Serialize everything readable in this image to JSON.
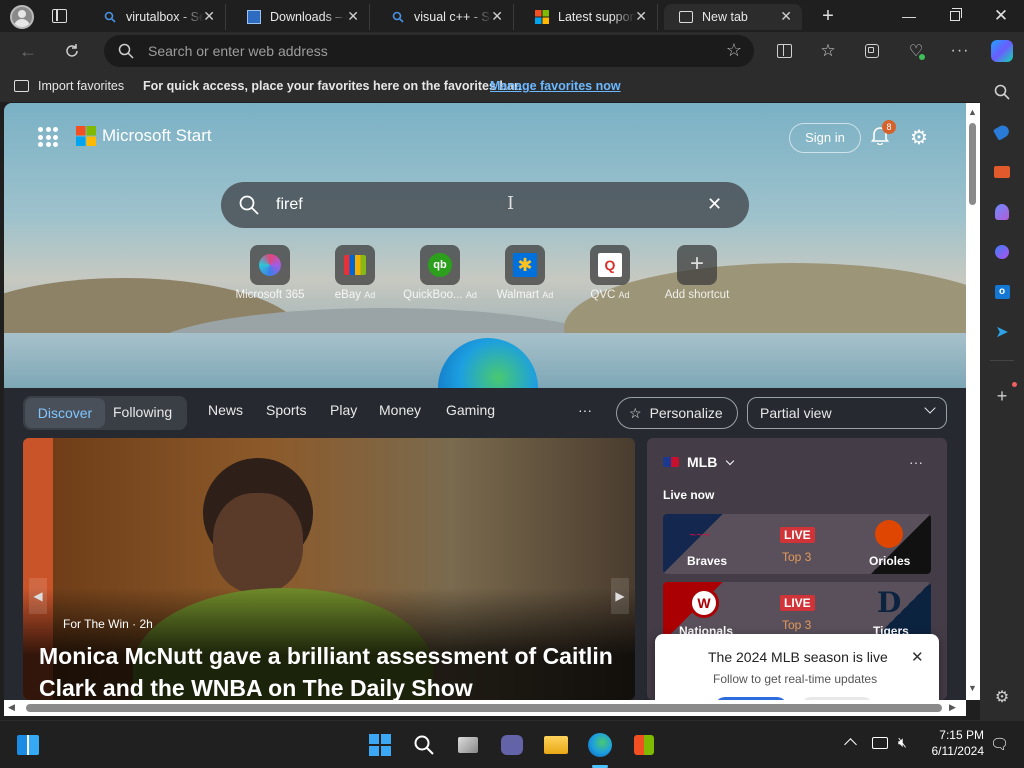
{
  "tabs": [
    {
      "title": "virutalbox - Se",
      "icon": "search-icon"
    },
    {
      "title": "Downloads – C",
      "icon": "page-icon"
    },
    {
      "title": "visual c++ - Se",
      "icon": "search-icon"
    },
    {
      "title": "Latest supporte",
      "icon": "microsoft-icon"
    },
    {
      "title": "New tab",
      "icon": "newtab-icon"
    }
  ],
  "address": {
    "placeholder": "Search or enter web address"
  },
  "favorites": {
    "import_label": "Import favorites",
    "message": "For quick access, place your favorites here on the favorites bar.",
    "manage_link": "Manage favorites now"
  },
  "start": {
    "brand": "Microsoft Start",
    "sign_in": "Sign in",
    "notif_count": "8",
    "search_value": "firef"
  },
  "shortcuts": [
    {
      "label": "Microsoft 365",
      "ad": ""
    },
    {
      "label": "eBay",
      "ad": "Ad"
    },
    {
      "label": "QuickBoo...",
      "ad": "Ad"
    },
    {
      "label": "Walmart",
      "ad": "Ad"
    },
    {
      "label": "QVC",
      "ad": "Ad"
    },
    {
      "label": "Add shortcut",
      "ad": ""
    }
  ],
  "nav": {
    "discover": "Discover",
    "following": "Following",
    "items": [
      "News",
      "Sports",
      "Play",
      "Money",
      "Gaming"
    ],
    "more": "···",
    "personalize": "Personalize",
    "view": "Partial view"
  },
  "hero": {
    "source": "For The Win · 2h",
    "headline": "Monica McNutt gave a brilliant assessment of Caitlin Clark and the WNBA on The Daily Show"
  },
  "mlb": {
    "title": "MLB",
    "live_now": "Live now",
    "games": [
      {
        "home": "Braves",
        "away": "Orioles",
        "status": "LIVE",
        "inning": "Top 3"
      },
      {
        "home": "Nationals",
        "away": "Tigers",
        "status": "LIVE",
        "inning": "Top 3"
      }
    ],
    "popup_title": "The 2024 MLB season is live",
    "popup_sub": "Follow to get real-time updates"
  },
  "clock": {
    "time": "7:15 PM",
    "date": "6/11/2024"
  },
  "colors": {
    "accent": "#4cc2ff",
    "live_red": "#d13438",
    "link": "#6cb8ff"
  }
}
